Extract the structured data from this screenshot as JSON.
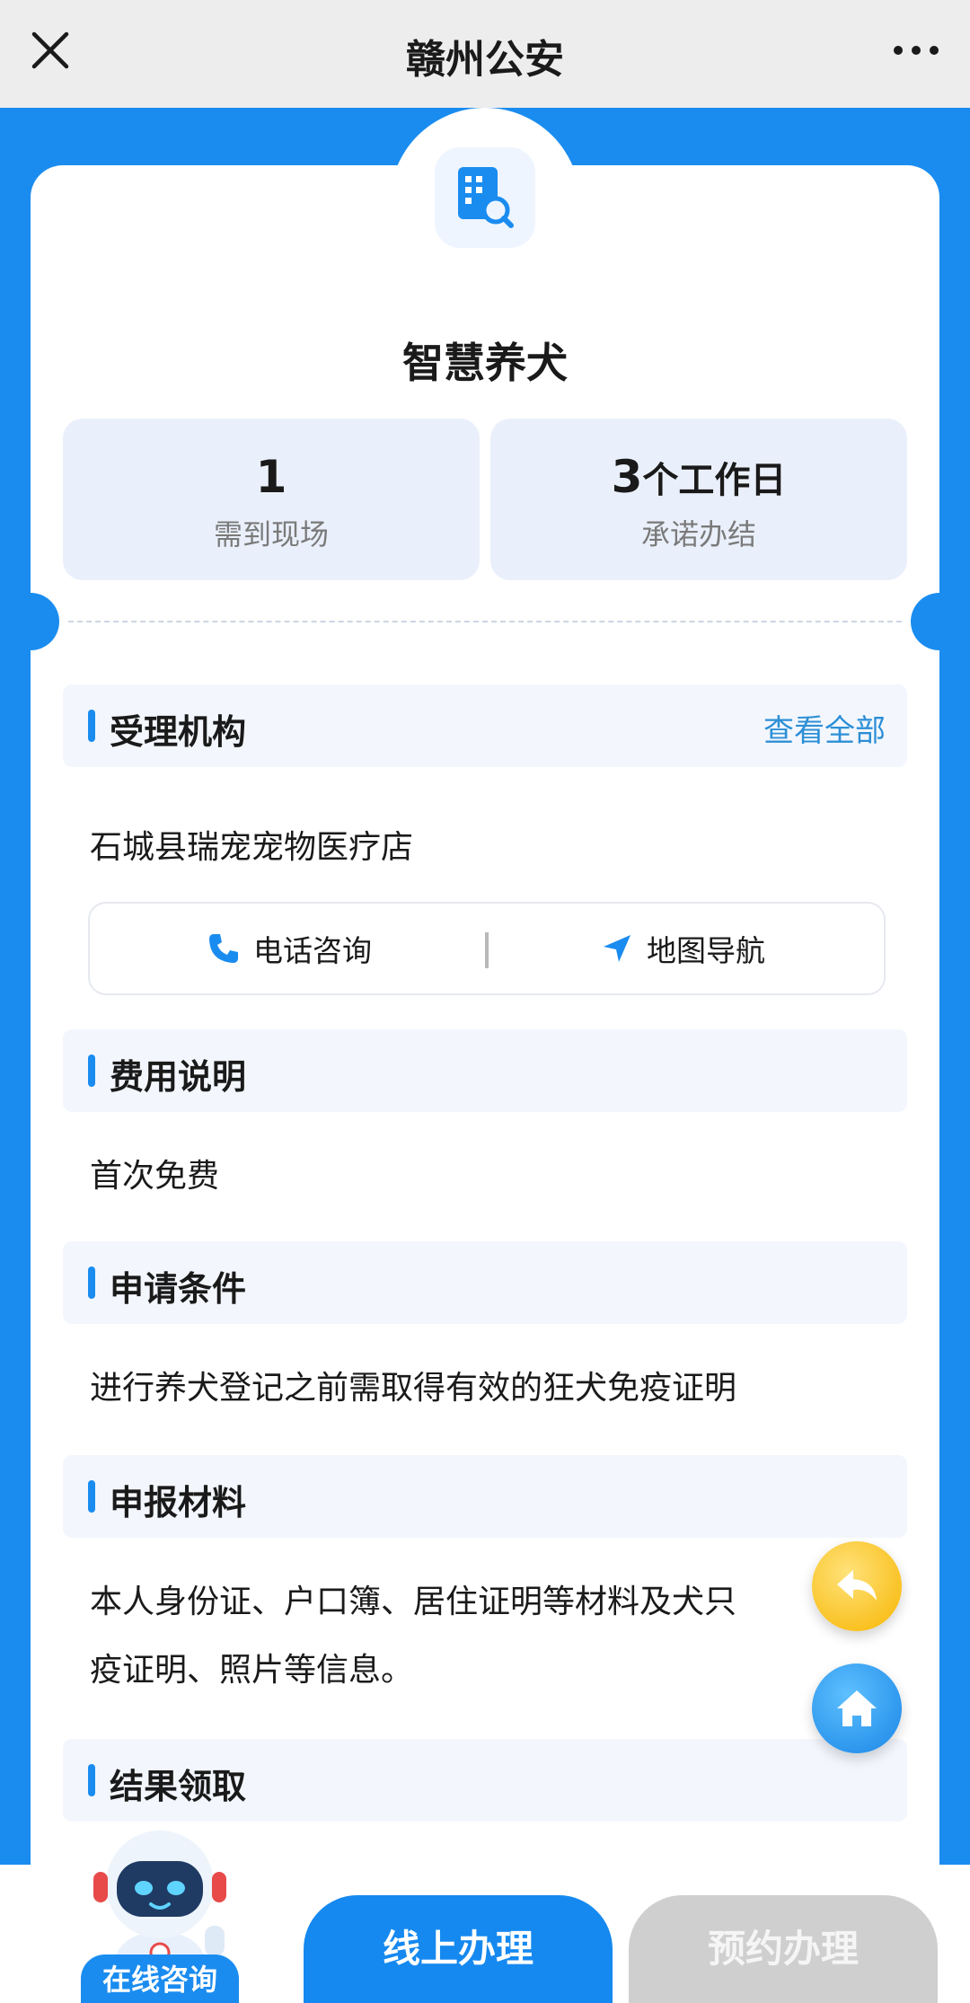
{
  "topbar": {
    "title": "赣州公安",
    "close_icon": "close-icon",
    "more_icon": "more-icon"
  },
  "service": {
    "icon": "building-search-icon",
    "title": "智慧养犬"
  },
  "stats": [
    {
      "value": "1",
      "unit": "",
      "label": "需到现场"
    },
    {
      "value": "3",
      "unit": "个工作日",
      "label": "承诺办结"
    }
  ],
  "sections": {
    "agency": {
      "title": "受理机构",
      "link": "查看全部",
      "name": "石城县瑞宠宠物医疗店",
      "phone_label": "电话咨询",
      "map_label": "地图导航"
    },
    "fees": {
      "title": "费用说明",
      "content": "首次免费"
    },
    "conditions": {
      "title": "申请条件",
      "content": "进行养犬登记之前需取得有效的狂犬免疫证明"
    },
    "materials": {
      "title": "申报材料",
      "line1": "本人身份证、户口簿、居住证明等材料及犬只",
      "line2": "疫证明、照片等信息。"
    },
    "result": {
      "title": "结果领取"
    }
  },
  "bottom": {
    "consult_label": "在线咨询",
    "online_label": "线上办理",
    "appoint_label": "预约办理"
  },
  "colors": {
    "primary": "#1a8cf0",
    "back_button": "#f7b500",
    "disabled": "#cfcfcf"
  }
}
